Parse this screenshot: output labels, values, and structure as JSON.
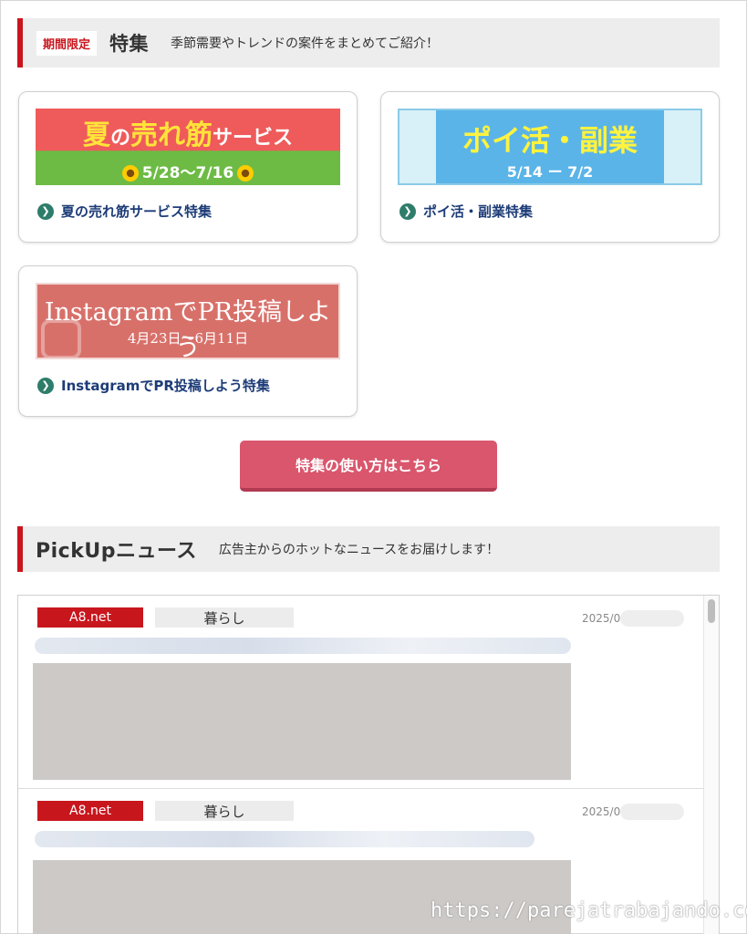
{
  "feature_section": {
    "badge": "期間限定",
    "title": "特集",
    "subtitle": "季節需要やトレンドの案件をまとめてご紹介！"
  },
  "feature_cards": [
    {
      "banner_title_a": "夏",
      "banner_title_b": "の",
      "banner_title_c": "売れ筋",
      "banner_title_d": "サービス",
      "banner_dates": "5/28～7/16",
      "link": "夏の売れ筋サービス特集"
    },
    {
      "banner_title": "ポイ活・副業",
      "banner_dates": "5/14 ー 7/2",
      "link": "ポイ活・副業特集"
    },
    {
      "banner_title": "InstagramでPR投稿しよう",
      "banner_dates": "4月23日～6月11日",
      "link": "InstagramでPR投稿しよう特集"
    }
  ],
  "howto_button": "特集の使い方はこちら",
  "news_section": {
    "title": "PickUpニュース",
    "subtitle": "広告主からのホットなニュースをお届けします！"
  },
  "news_items": [
    {
      "source": "A8.net",
      "category": "暮らし",
      "date": "2025/0"
    },
    {
      "source": "A8.net",
      "category": "暮らし",
      "date": "2025/0"
    }
  ],
  "watermark": "https://parejatrabajando.com/",
  "colors": {
    "accent_red": "#c8161d",
    "button_pink": "#d9566d",
    "link_navy": "#1d3c78"
  }
}
